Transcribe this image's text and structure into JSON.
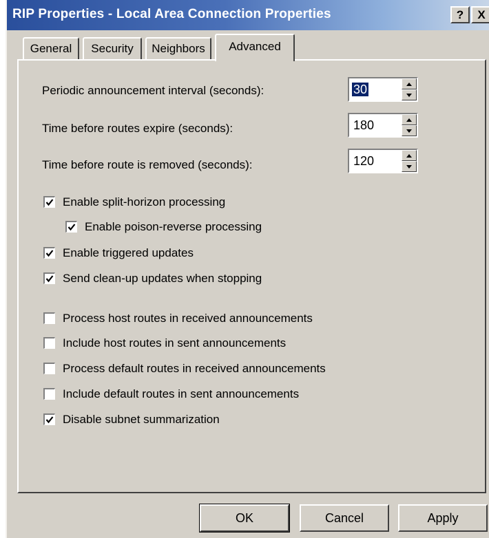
{
  "window": {
    "title": "RIP Properties - Local Area Connection Properties",
    "help_label": "?",
    "close_label": "X"
  },
  "tabs": [
    {
      "label": "General",
      "active": false
    },
    {
      "label": "Security",
      "active": false
    },
    {
      "label": "Neighbors",
      "active": false
    },
    {
      "label": "Advanced",
      "active": true
    }
  ],
  "fields": [
    {
      "label": "Periodic announcement interval (seconds):",
      "value": "30"
    },
    {
      "label": "Time before routes expire (seconds):",
      "value": "180"
    },
    {
      "label": "Time before route is removed (seconds):",
      "value": "120"
    }
  ],
  "checkboxes": [
    {
      "label": "Enable split-horizon processing",
      "checked": true
    },
    {
      "label": "Enable poison-reverse processing",
      "checked": true
    },
    {
      "label": "Enable triggered updates",
      "checked": true
    },
    {
      "label": "Send clean-up updates when stopping",
      "checked": true
    },
    {
      "label": "Process host routes in received announcements",
      "checked": false
    },
    {
      "label": "Include host routes in sent announcements",
      "checked": false
    },
    {
      "label": "Process default routes in received announcements",
      "checked": false
    },
    {
      "label": "Include default routes in sent announcements",
      "checked": false
    },
    {
      "label": "Disable subnet summarization",
      "checked": true
    }
  ],
  "buttons": {
    "ok": "OK",
    "cancel": "Cancel",
    "apply": "Apply"
  }
}
